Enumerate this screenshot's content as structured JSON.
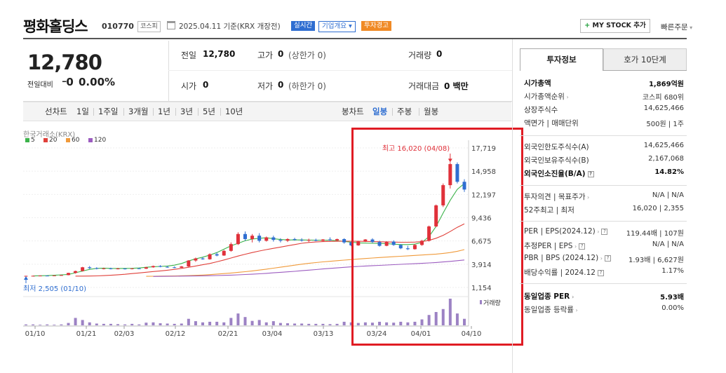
{
  "header": {
    "title": "평화홀딩스",
    "code": "010770",
    "market": "코스피",
    "date": "2025.04.11 기준(KRX 개장전)",
    "realtime": "실시간",
    "company_info": "기업개요",
    "warning": "투자경고",
    "mystock": "MY STOCK 추가",
    "quick_order": "빠른주문"
  },
  "price": {
    "current": "12,780",
    "change_label": "전일대비",
    "change": "0",
    "change_pct": "0.00%"
  },
  "stats": {
    "prev_close_label": "전일",
    "prev_close": "12,780",
    "high_label": "고가",
    "high": "0",
    "high_limit": "(상한가 0)",
    "volume_label": "거래량",
    "volume": "0",
    "open_label": "시가",
    "open": "0",
    "low_label": "저가",
    "low": "0",
    "low_limit": "(하한가 0)",
    "amount_label": "거래대금",
    "amount": "0 백만"
  },
  "periods": {
    "line_chart": "선차트",
    "items": [
      "1일",
      "1주일",
      "3개월",
      "1년",
      "3년",
      "5년",
      "10년"
    ],
    "candle_chart": "봉차트",
    "candle_items": [
      "일봉",
      "주봉",
      "월봉"
    ],
    "active": "일봉"
  },
  "chart": {
    "source": "한국거래소(KRX)",
    "legend": [
      {
        "label": "5",
        "color": "#3cb34a"
      },
      {
        "label": "20",
        "color": "#e0403a"
      },
      {
        "label": "60",
        "color": "#f09a3a"
      },
      {
        "label": "120",
        "color": "#9c5cc0"
      }
    ],
    "high_annotation": "최고 16,020 (04/08)",
    "low_annotation": "최저 2,505 (01/10)",
    "volume_label": "거래량"
  },
  "chart_data": {
    "type": "candlestick",
    "y_ticks": [
      "17,719",
      "14,958",
      "12,197",
      "9,436",
      "6,675",
      "3,914",
      "1,154"
    ],
    "x_ticks": [
      "01/10",
      "01/21",
      "02/03",
      "02/12",
      "02/21",
      "03/04",
      "03/13",
      "03/24",
      "04/01",
      "04/10"
    ],
    "ylim": [
      1154,
      17719
    ],
    "high": 16020,
    "low": 2505,
    "candles": [
      [
        2505,
        2550,
        2480,
        2530
      ],
      [
        2530,
        2560,
        2500,
        2540
      ],
      [
        2540,
        2580,
        2510,
        2560
      ],
      [
        2560,
        2580,
        2520,
        2550
      ],
      [
        2550,
        2600,
        2530,
        2580
      ],
      [
        2580,
        2640,
        2560,
        2620
      ],
      [
        2620,
        2900,
        2600,
        2880
      ],
      [
        2880,
        3150,
        2800,
        3100
      ],
      [
        3100,
        3600,
        3050,
        3550
      ],
      [
        3550,
        3700,
        3350,
        3450
      ],
      [
        3450,
        3550,
        3300,
        3400
      ],
      [
        3400,
        3500,
        3300,
        3420
      ],
      [
        3420,
        3500,
        3300,
        3380
      ],
      [
        3380,
        3480,
        3300,
        3400
      ],
      [
        3400,
        3450,
        3280,
        3350
      ],
      [
        3350,
        3450,
        3300,
        3420
      ],
      [
        3420,
        3500,
        3350,
        3380
      ],
      [
        3380,
        3600,
        3350,
        3550
      ],
      [
        3550,
        3750,
        3500,
        3700
      ],
      [
        3700,
        3800,
        3550,
        3600
      ],
      [
        3600,
        3700,
        3500,
        3550
      ],
      [
        3550,
        3650,
        3450,
        3500
      ],
      [
        3500,
        3700,
        3480,
        3650
      ],
      [
        3650,
        4400,
        3600,
        4350
      ],
      [
        4350,
        4700,
        4200,
        4600
      ],
      [
        4600,
        4750,
        4450,
        4500
      ],
      [
        4500,
        5200,
        4450,
        5100
      ],
      [
        5100,
        5300,
        4850,
        4950
      ],
      [
        4950,
        5600,
        4900,
        5500
      ],
      [
        5500,
        6500,
        5400,
        6300
      ],
      [
        6300,
        7700,
        6200,
        7500
      ],
      [
        7500,
        7800,
        6700,
        6900
      ],
      [
        6900,
        7500,
        6500,
        7300
      ],
      [
        7300,
        7600,
        6500,
        6700
      ],
      [
        6700,
        7200,
        6600,
        7100
      ],
      [
        7100,
        7300,
        6600,
        6800
      ],
      [
        6800,
        7000,
        6500,
        6700
      ],
      [
        6700,
        7000,
        6550,
        6900
      ],
      [
        6900,
        7050,
        6700,
        6800
      ],
      [
        6800,
        7000,
        6600,
        6750
      ],
      [
        6750,
        6950,
        6550,
        6800
      ],
      [
        6800,
        6950,
        6650,
        6700
      ],
      [
        6700,
        6900,
        6600,
        6850
      ],
      [
        6850,
        7100,
        6700,
        6750
      ],
      [
        6750,
        6950,
        6600,
        6900
      ],
      [
        6900,
        7000,
        6350,
        6500
      ],
      [
        6500,
        6650,
        6050,
        6150
      ],
      [
        6150,
        6700,
        6100,
        6600
      ],
      [
        6600,
        6900,
        6550,
        6850
      ],
      [
        6850,
        7000,
        6450,
        6550
      ],
      [
        6550,
        6700,
        6000,
        6100
      ],
      [
        6100,
        6650,
        6050,
        6600
      ],
      [
        6600,
        6750,
        6100,
        6200
      ],
      [
        6200,
        6300,
        5700,
        5800
      ],
      [
        5800,
        6100,
        5600,
        5700
      ],
      [
        5700,
        6300,
        5650,
        6200
      ],
      [
        6200,
        6800,
        6100,
        6700
      ],
      [
        6700,
        8500,
        6600,
        8400
      ],
      [
        8400,
        11000,
        8300,
        10900
      ],
      [
        10900,
        13500,
        10700,
        13300
      ],
      [
        13300,
        16020,
        12900,
        15800
      ],
      [
        15800,
        16000,
        13500,
        13700
      ],
      [
        13700,
        14000,
        12500,
        12780
      ]
    ],
    "volumes": [
      3,
      3,
      2,
      3,
      2,
      3,
      8,
      25,
      18,
      10,
      6,
      5,
      5,
      4,
      3,
      5,
      3,
      9,
      10,
      7,
      6,
      5,
      6,
      22,
      14,
      10,
      12,
      12,
      10,
      25,
      40,
      28,
      15,
      18,
      10,
      14,
      8,
      7,
      6,
      6,
      5,
      5,
      5,
      4,
      5,
      12,
      10,
      8,
      10,
      9,
      12,
      10,
      9,
      12,
      10,
      12,
      20,
      35,
      45,
      55,
      90,
      40,
      22
    ],
    "ma": {
      "5": [
        2520,
        2540,
        2560,
        2600,
        2650,
        2700,
        2900,
        3100,
        3300,
        3420,
        3450,
        3420,
        3410,
        3420,
        3430,
        3470,
        3550,
        3620,
        3650,
        3700,
        3800,
        4000,
        4300,
        4550,
        4750,
        5000,
        5300,
        5700,
        6100,
        6400,
        6700,
        6900,
        7000,
        7050,
        6950,
        6850,
        6800,
        6800,
        6800,
        6780,
        6770,
        6760,
        6770,
        6700,
        6620,
        6520,
        6450,
        6420,
        6400,
        6380,
        6360,
        6300,
        6250,
        6250,
        6300,
        6500,
        7200,
        8400,
        10000,
        11500,
        12800,
        13500
      ],
      "20": [
        2500,
        2500,
        2510,
        2530,
        2560,
        2600,
        2660,
        2720,
        2800,
        2880,
        2960,
        3040,
        3120,
        3200,
        3300,
        3420,
        3550,
        3700,
        3850,
        4000,
        4200,
        4420,
        4650,
        4880,
        5100,
        5300,
        5480,
        5650,
        5800,
        5950,
        6100,
        6250,
        6400,
        6500,
        6560,
        6600,
        6620,
        6640,
        6650,
        6650,
        6640,
        6620,
        6600,
        6580,
        6560,
        6540,
        6520,
        6520,
        6540,
        6600,
        6750,
        7000,
        7350,
        7800,
        8300,
        8700
      ],
      "60": [
        2480,
        2490,
        2500,
        2510,
        2520,
        2540,
        2560,
        2590,
        2630,
        2680,
        2740,
        2800,
        2870,
        2950,
        3030,
        3120,
        3220,
        3330,
        3440,
        3560,
        3680,
        3800,
        3920,
        4020,
        4110,
        4190,
        4260,
        4330,
        4400,
        4470,
        4530,
        4590,
        4650,
        4710,
        4760,
        4810,
        4860,
        4910,
        4960,
        5010,
        5060,
        5120,
        5200,
        5300,
        5450,
        5650
      ],
      "120": [
        2460,
        2470,
        2480,
        2490,
        2500,
        2510,
        2520,
        2535,
        2550,
        2570,
        2590,
        2620,
        2650,
        2690,
        2730,
        2780,
        2830,
        2890,
        2950,
        3010,
        3070,
        3140,
        3210,
        3280,
        3350,
        3420,
        3480,
        3540,
        3600,
        3650,
        3700,
        3740,
        3780,
        3820,
        3860,
        3900,
        3940,
        3980,
        4020,
        4070,
        4120,
        4180,
        4250,
        4330,
        4420
      ]
    }
  },
  "invest_panel": {
    "tab_invest": "투자정보",
    "tab_hoga": "호가 10단계",
    "rows": [
      {
        "label": "시가총액",
        "value": "1,869억원",
        "bold": true
      },
      {
        "label": "시가총액순위",
        "value": "코스피 680위"
      },
      {
        "label": "상장주식수",
        "value": "14,625,466"
      },
      {
        "label": "액면가 | 매매단위",
        "value": "500원 | 1주"
      },
      {
        "label": "외국인한도주식수(A)",
        "value": "14,625,466"
      },
      {
        "label": "외국인보유주식수(B)",
        "value": "2,167,068"
      },
      {
        "label": "외국인소진율(B/A)",
        "value": "14.82%",
        "bold": true
      },
      {
        "label": "투자의견 | 목표주가",
        "value": "N/A | N/A"
      },
      {
        "label": "52주최고 | 최저",
        "value": "16,020 | 2,355"
      },
      {
        "label": "PER | EPS(2024.12)",
        "value": "119.44배 | 107원"
      },
      {
        "label": "추정PER | EPS",
        "value": "N/A | N/A"
      },
      {
        "label": "PBR | BPS (2024.12)",
        "value": "1.93배 | 6,627원"
      },
      {
        "label": "배당수익률 | 2024.12",
        "value": "1.17%"
      },
      {
        "label": "동일업종 PER",
        "value": "5.93배",
        "bold": true
      },
      {
        "label": "동일업종 등락률",
        "value": "0.00%"
      }
    ]
  }
}
